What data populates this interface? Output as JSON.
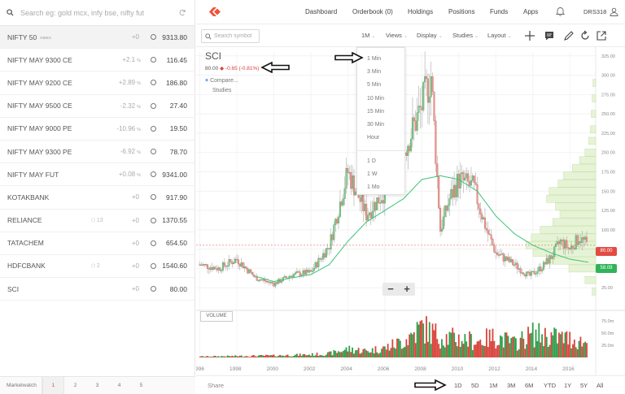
{
  "watchlist": {
    "search_placeholder": "Search eg: gold mcx, infy bse, nifty fut",
    "items": [
      {
        "name": "NIFTY 50",
        "tag": "INDEX",
        "qty": "",
        "change": "+0",
        "change_unit": "",
        "price": "9313.80"
      },
      {
        "name": "NIFTY MAY 9300 CE",
        "tag": "",
        "qty": "",
        "change": "+2.1",
        "change_unit": "%",
        "price": "116.45"
      },
      {
        "name": "NIFTY MAY 9200 CE",
        "tag": "",
        "qty": "",
        "change": "+2.89",
        "change_unit": "%",
        "price": "186.80"
      },
      {
        "name": "NIFTY MAY 9500 CE",
        "tag": "",
        "qty": "",
        "change": "-2.32",
        "change_unit": "%",
        "price": "27.40"
      },
      {
        "name": "NIFTY MAY 9000 PE",
        "tag": "",
        "qty": "",
        "change": "-10.96",
        "change_unit": "%",
        "price": "19.50"
      },
      {
        "name": "NIFTY MAY 9300 PE",
        "tag": "",
        "qty": "",
        "change": "-6.92",
        "change_unit": "%",
        "price": "78.70"
      },
      {
        "name": "NIFTY MAY FUT",
        "tag": "",
        "qty": "",
        "change": "+0.08",
        "change_unit": "%",
        "price": "9341.00"
      },
      {
        "name": "KOTAKBANK",
        "tag": "",
        "qty": "",
        "change": "+0",
        "change_unit": "",
        "price": "917.90"
      },
      {
        "name": "RELIANCE",
        "tag": "",
        "qty": "13",
        "change": "+0",
        "change_unit": "",
        "price": "1370.55"
      },
      {
        "name": "TATACHEM",
        "tag": "",
        "qty": "",
        "change": "+0",
        "change_unit": "",
        "price": "654.50"
      },
      {
        "name": "HDFCBANK",
        "tag": "",
        "qty": "2",
        "change": "+0",
        "change_unit": "",
        "price": "1540.60"
      },
      {
        "name": "SCI",
        "tag": "",
        "qty": "",
        "change": "+0",
        "change_unit": "",
        "price": "80.00"
      }
    ],
    "footer_label": "Marketwatch",
    "pages": [
      "1",
      "2",
      "3",
      "4",
      "5"
    ]
  },
  "nav": {
    "links": [
      "Dashboard",
      "Orderbook (0)",
      "Holdings",
      "Positions",
      "Funds",
      "Apps"
    ],
    "user_id": "DRS318"
  },
  "toolbar": {
    "symbol_search_placeholder": "Search symbol",
    "interval": "1M",
    "views": "Views",
    "display": "Display",
    "studies": "Studies",
    "layout": "Layout"
  },
  "symbol": {
    "name": "SCI",
    "price": "80.00",
    "change": "-0.65 (-0.81%)",
    "compare": "Compare...",
    "studies": "Studies"
  },
  "interval_menu": {
    "minutes": [
      "1 Min",
      "3 Min",
      "5 Min",
      "10 Min",
      "15 Min",
      "30 Min",
      "Hour"
    ],
    "days": [
      "1 D",
      "1 W",
      "1 Mo"
    ]
  },
  "chart_panel": {
    "volume_label": "VOLUME",
    "last_price_tag": "80.00",
    "ma_tag": "58.09",
    "colors": {
      "up": "#2e9e4a",
      "down": "#d9433a",
      "ma": "#3cc27a",
      "profile": "#d7eec0",
      "last_price": "#e24b43"
    }
  },
  "chart_data": {
    "type": "candlestick",
    "price_axis": [
      325,
      300,
      275,
      250,
      225,
      200,
      175,
      150,
      125,
      100,
      75,
      50,
      25
    ],
    "price_ylim": [
      0,
      330
    ],
    "volume_axis": [
      "75.0m",
      "50.0m",
      "25.0m"
    ],
    "volume_ylim": [
      0,
      90
    ],
    "x_ticks": [
      "1996",
      "1998",
      "2000",
      "2002",
      "2004",
      "2006",
      "2008",
      "2010",
      "2012",
      "2014",
      "2016"
    ],
    "x_range": [
      1995.8,
      2017.4
    ],
    "price_path": [
      [
        1996.0,
        55
      ],
      [
        1997.0,
        50
      ],
      [
        1998.0,
        62
      ],
      [
        1999.0,
        38
      ],
      [
        2000.0,
        30
      ],
      [
        2001.0,
        42
      ],
      [
        2002.0,
        45
      ],
      [
        2003.0,
        80
      ],
      [
        2004.0,
        175
      ],
      [
        2005.0,
        120
      ],
      [
        2006.0,
        150
      ],
      [
        2007.0,
        200
      ],
      [
        2008.0,
        260
      ],
      [
        2008.5,
        300
      ],
      [
        2009.0,
        100
      ],
      [
        2009.5,
        140
      ],
      [
        2010.0,
        165
      ],
      [
        2010.8,
        155
      ],
      [
        2011.5,
        100
      ],
      [
        2012.0,
        70
      ],
      [
        2013.0,
        55
      ],
      [
        2013.8,
        40
      ],
      [
        2014.5,
        52
      ],
      [
        2015.0,
        65
      ],
      [
        2015.5,
        85
      ],
      [
        2016.0,
        75
      ],
      [
        2016.5,
        90
      ],
      [
        2017.0,
        80
      ]
    ],
    "moving_average": [
      [
        1999.0,
        40
      ],
      [
        2000.0,
        33
      ],
      [
        2001.0,
        38
      ],
      [
        2002.0,
        42
      ],
      [
        2003.0,
        55
      ],
      [
        2004.0,
        85
      ],
      [
        2005.0,
        110
      ],
      [
        2006.0,
        125
      ],
      [
        2007.0,
        140
      ],
      [
        2008.0,
        165
      ],
      [
        2009.0,
        170
      ],
      [
        2010.0,
        165
      ],
      [
        2011.0,
        150
      ],
      [
        2012.0,
        118
      ],
      [
        2013.0,
        95
      ],
      [
        2014.0,
        80
      ],
      [
        2015.0,
        70
      ],
      [
        2016.0,
        62
      ],
      [
        2017.0,
        58
      ]
    ],
    "volume": [
      [
        1996,
        2
      ],
      [
        1998,
        3
      ],
      [
        2000,
        4
      ],
      [
        2002,
        6
      ],
      [
        2003,
        8
      ],
      [
        2004,
        18
      ],
      [
        2005,
        14
      ],
      [
        2006,
        20
      ],
      [
        2007,
        35
      ],
      [
        2008,
        65
      ],
      [
        2009,
        45
      ],
      [
        2010,
        40
      ],
      [
        2011,
        35
      ],
      [
        2012,
        45
      ],
      [
        2013,
        30
      ],
      [
        2014,
        50
      ],
      [
        2015,
        45
      ],
      [
        2016,
        40
      ],
      [
        2017,
        30
      ]
    ],
    "last_price": 80.0,
    "ma_last": 58.09
  },
  "range_bar": {
    "share": "Share",
    "ranges": [
      "1D",
      "5D",
      "1M",
      "3M",
      "6M",
      "YTD",
      "1Y",
      "5Y",
      "All"
    ]
  }
}
